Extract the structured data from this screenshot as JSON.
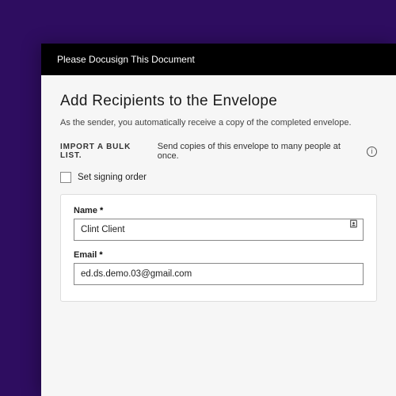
{
  "titlebar": {
    "text": "Please Docusign This Document"
  },
  "page": {
    "heading": "Add Recipients to the Envelope",
    "subtext": "As the sender, you automatically receive a copy of the completed envelope."
  },
  "bulk": {
    "label": "IMPORT A BULK LIST.",
    "desc": "Send copies of this envelope to many people at once."
  },
  "signing_order": {
    "label": "Set signing order"
  },
  "recipient": {
    "name_label": "Name",
    "name_value": "Clint Client",
    "email_label": "Email",
    "email_value": "ed.ds.demo.03@gmail.com",
    "required_mark": "*"
  }
}
